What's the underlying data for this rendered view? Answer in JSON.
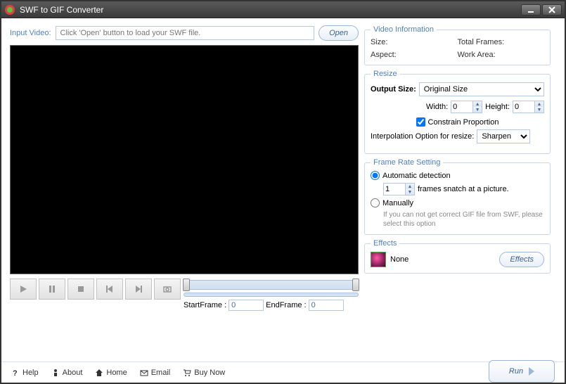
{
  "window": {
    "title": "SWF to GIF Converter"
  },
  "input": {
    "label": "Input Video:",
    "placeholder": "Click 'Open' button to load your SWF file.",
    "open": "Open"
  },
  "player": {
    "startframe_label": "StartFrame :",
    "endframe_label": "EndFrame :",
    "startframe": "0",
    "endframe": "0"
  },
  "video_info": {
    "legend": "Video Information",
    "size_label": "Size:",
    "total_frames_label": "Total Frames:",
    "aspect_label": "Aspect:",
    "work_area_label": "Work Area:"
  },
  "resize": {
    "legend": "Resize",
    "output_size_label": "Output Size:",
    "output_size_value": "Original Size",
    "width_label": "Width:",
    "width_value": "0",
    "height_label": "Height:",
    "height_value": "0",
    "constrain_label": "Constrain Proportion",
    "interp_label": "Interpolation Option for resize:",
    "interp_value": "Sharpen"
  },
  "frs": {
    "legend": "Frame Rate Setting",
    "auto_label": "Automatic detection",
    "snatch_value": "1",
    "snatch_suffix": "frames snatch at a picture.",
    "manual_label": "Manually",
    "manual_hint": "If you can not get correct GIF file from SWF, please select this option"
  },
  "effects": {
    "legend": "Effects",
    "name": "None",
    "button": "Effects"
  },
  "bottom": {
    "help": "Help",
    "about": "About",
    "home": "Home",
    "email": "Email",
    "buy": "Buy Now",
    "run": "Run"
  }
}
